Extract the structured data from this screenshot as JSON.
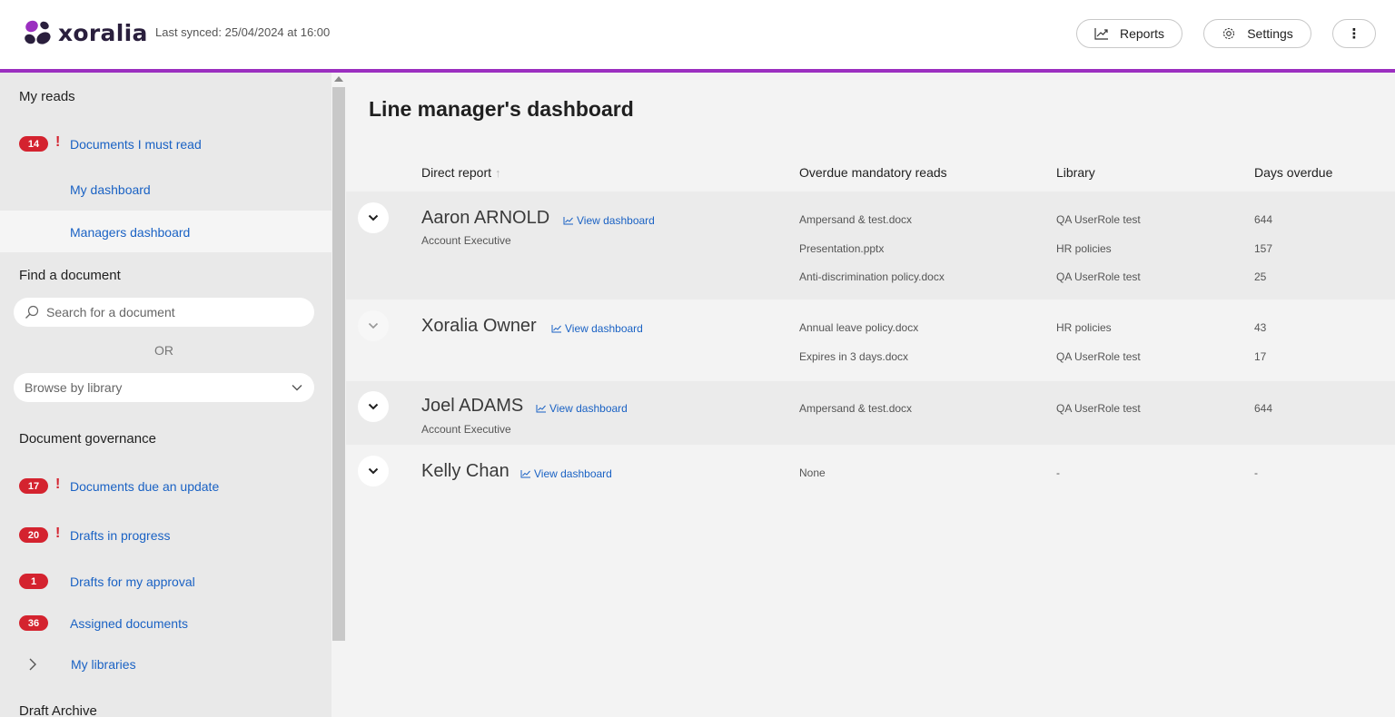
{
  "header": {
    "logo_text": "xoralia",
    "sync_text": "Last synced: 25/04/2024 at 16:00",
    "reports_label": "Reports",
    "settings_label": "Settings",
    "more_label": "⋮",
    "accent_color": "#9b2fc0"
  },
  "sidebar": {
    "my_reads_title": "My reads",
    "must_read": {
      "count": "14",
      "label": "Documents I must read"
    },
    "my_dashboard": "My dashboard",
    "managers_dashboard": "Managers dashboard",
    "find_title": "Find a document",
    "search_placeholder": "Search for a document",
    "or_text": "OR",
    "browse_label": "Browse by library",
    "governance_title": "Document governance",
    "due_update": {
      "count": "17",
      "label": "Documents due an update"
    },
    "drafts_progress": {
      "count": "20",
      "label": "Drafts in progress"
    },
    "drafts_approval": {
      "count": "1",
      "label": "Drafts for my approval"
    },
    "assigned": {
      "count": "36",
      "label": "Assigned documents"
    },
    "my_libraries": "My libraries",
    "draft_archive": "Draft Archive",
    "badge_color": "#d4232f",
    "link_color": "#1a62c4"
  },
  "main": {
    "title": "Line manager's dashboard",
    "columns": {
      "direct_report": "Direct report",
      "overdue": "Overdue mandatory reads",
      "library": "Library",
      "days": "Days overdue"
    },
    "view_dashboard_label": "View dashboard",
    "reports": [
      {
        "name": "Aaron ARNOLD",
        "role": "Account Executive",
        "items": [
          {
            "doc": "Ampersand & test.docx",
            "library": "QA UserRole test",
            "days": "644"
          },
          {
            "doc": "Presentation.pptx",
            "library": "HR policies",
            "days": "157"
          },
          {
            "doc": "Anti-discrimination policy.docx",
            "library": "QA UserRole test",
            "days": "25"
          }
        ]
      },
      {
        "name": "Xoralia Owner",
        "role": "",
        "items": [
          {
            "doc": "Annual leave policy.docx",
            "library": "HR policies",
            "days": "43"
          },
          {
            "doc": "Expires in 3 days.docx",
            "library": "QA UserRole test",
            "days": "17"
          }
        ]
      },
      {
        "name": "Joel ADAMS",
        "role": "Account Executive",
        "items": [
          {
            "doc": "Ampersand & test.docx",
            "library": "QA UserRole test",
            "days": "644"
          }
        ]
      },
      {
        "name": "Kelly Chan",
        "role": "",
        "items": [
          {
            "doc": "None",
            "library": "-",
            "days": "-"
          }
        ]
      }
    ]
  }
}
